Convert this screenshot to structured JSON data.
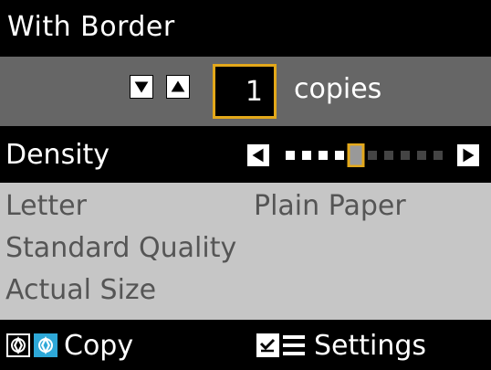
{
  "header": {
    "title": "With Border"
  },
  "copies": {
    "value": "1",
    "label": "copies"
  },
  "density": {
    "label": "Density",
    "level": 5,
    "max": 10
  },
  "settings_summary": {
    "paper_size": "Letter",
    "paper_type": "Plain Paper",
    "quality": "Standard Quality",
    "size": "Actual Size"
  },
  "footer": {
    "copy_label": "Copy",
    "settings_label": "Settings"
  },
  "colors": {
    "accent": "#e3a81a",
    "panel_gray": "#666666",
    "info_gray": "#c6c6c6",
    "start_blue": "#2ea8d8"
  },
  "icons": {
    "decrease": "down-triangle-icon",
    "increase": "up-triangle-icon",
    "left": "left-triangle-icon",
    "right": "right-triangle-icon",
    "start_bw": "start-bw-icon",
    "start_color": "start-color-icon",
    "menu": "menu-icon"
  }
}
